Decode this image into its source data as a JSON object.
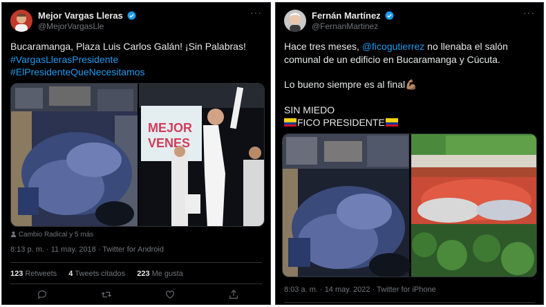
{
  "tweets": [
    {
      "author": {
        "name": "Mejor Vargas Lleras",
        "handle": "@MejorVargasLle"
      },
      "more_label": "···",
      "text_lines": [
        "Bucaramanga, Plaza Luis Carlos Galán! ¡Sin Palabras!"
      ],
      "hashtags": [
        "#VargasLlerasPresidente",
        "#ElPresidenteQueNecesitamos"
      ],
      "media": [
        {
          "icon": "crowd-plaza-night-photo"
        },
        {
          "icon": "candidate-stage-photo",
          "stage_text_1": "MEJOR",
          "stage_text_2": "VENES"
        }
      ],
      "tagged": "Cambio Radical y 5 más",
      "timestamp": "8:13 p. m. · 11 may. 2018 · Twitter for Android",
      "stats": [
        {
          "count": "123",
          "label": "Retweets"
        },
        {
          "count": "4",
          "label": "Tweets citados"
        },
        {
          "count": "223",
          "label": "Me gusta"
        }
      ],
      "actions": [
        "reply-icon",
        "retweet-icon",
        "like-icon",
        "share-icon"
      ]
    },
    {
      "author": {
        "name": "Fernán Martínez",
        "handle": "@FernanMartinez"
      },
      "more_label": "···",
      "line1_pre": "Hace tres meses, ",
      "mention": "@ficogutierrez",
      "line1_post": " no llenaba el salón",
      "line2": "comunal de un edificio en Bucaramanga y Cúcuta.",
      "line3": "Lo bueno siempre es al final",
      "emoji_flex": "💪🏽",
      "line4": "SIN MIEDO",
      "line5": "FICO PRESIDENTE",
      "flag_icon": "colombia-flag-icon",
      "media": [
        {
          "icon": "crowd-plaza-night-photo"
        },
        {
          "icon": "stadium-crowd-red-photo"
        }
      ],
      "timestamp": "8:03 a. m. · 14 may. 2022 · Twitter for iPhone"
    }
  ],
  "colors": {
    "background": "#000000",
    "text": "#e7e9ea",
    "muted": "#71767b",
    "link": "#1d9bf0",
    "verified": "#1d9bf0",
    "divider": "#2f3336"
  }
}
